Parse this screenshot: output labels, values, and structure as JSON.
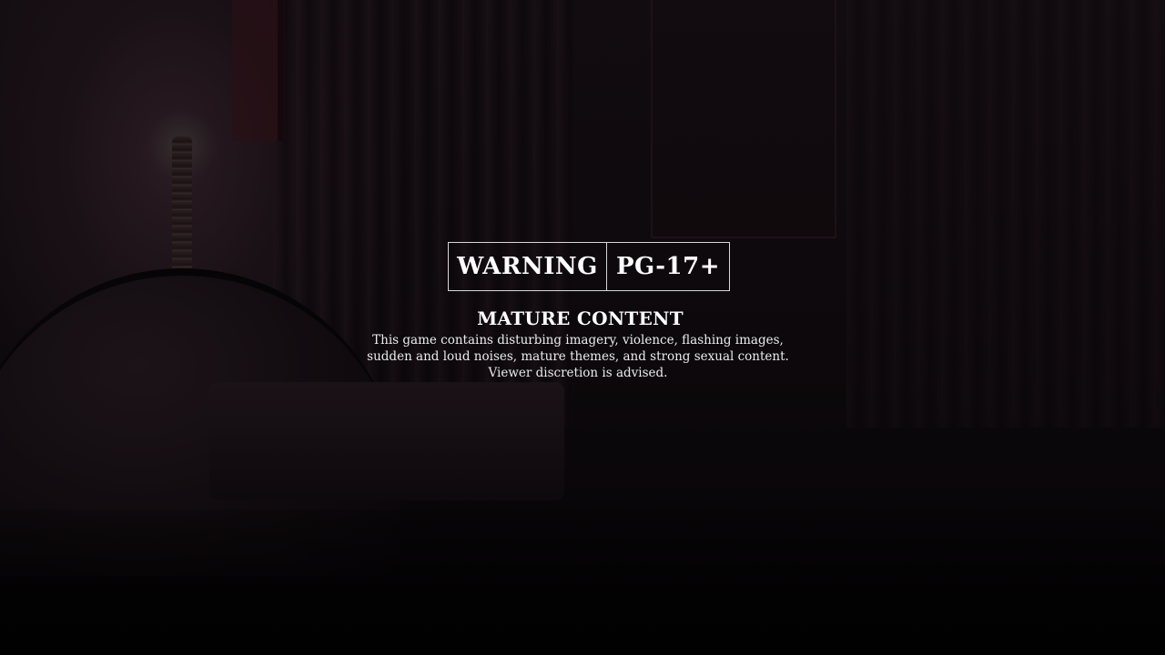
{
  "warning": {
    "label": "WARNING",
    "rating": "PG-17+"
  },
  "content": {
    "title": "MATURE CONTENT",
    "lines": [
      "This game contains disturbing imagery, violence, flashing images,",
      "sudden and loud noises, mature themes, and strong sexual content.",
      "Viewer discretion is advised."
    ]
  },
  "colors": {
    "text": "#ffffff",
    "border": "#d8d8d8",
    "background": "#0c080b"
  }
}
